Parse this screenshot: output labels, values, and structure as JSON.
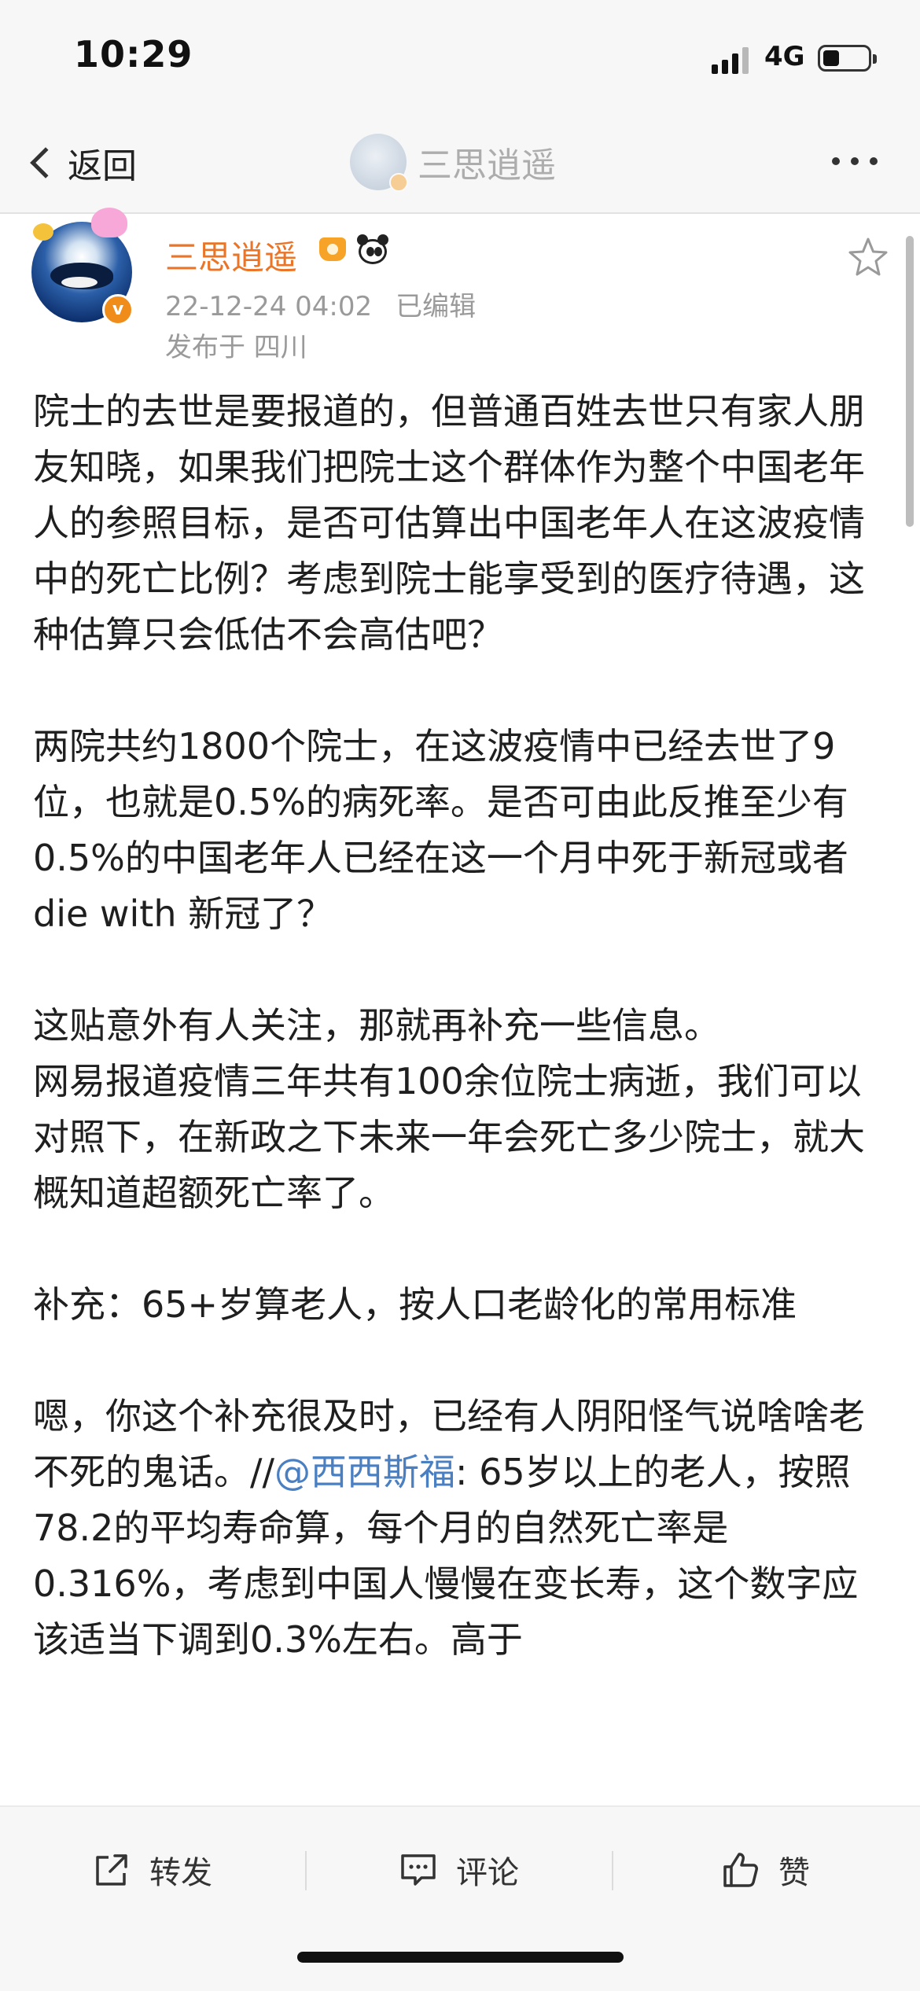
{
  "status_bar": {
    "time": "10:29",
    "network": "4G",
    "signal_icon": "signal-bars-icon",
    "battery_icon": "battery-icon"
  },
  "nav": {
    "back_label": "返回",
    "title": "三思逍遥",
    "more_icon": "more-dots-icon"
  },
  "author": {
    "name": "三思逍遥",
    "timestamp": "22-12-24 04:02",
    "edited": "已编辑",
    "location": "发布于 四川",
    "verified_mark": "v",
    "name_color": "#ea7528"
  },
  "post": {
    "paragraphs": [
      "院士的去世是要报道的，但普通百姓去世只有家人朋友知晓，如果我们把院士这个群体作为整个中国老年人的参照目标，是否可估算出中国老年人在这波疫情中的死亡比例？考虑到院士能享受到的医疗待遇，这种估算只会低估不会高估吧？",
      "两院共约1800个院士，在这波疫情中已经去世了9位，也就是0.5%的病死率。是否可由此反推至少有0.5%的中国老年人已经在这一个月中死于新冠或者 die with 新冠了？",
      "这贴意外有人关注，那就再补充一些信息。\n网易报道疫情三年共有100余位院士病逝，我们可以对照下，在新政之下未来一年会死亡多少院士，就大概知道超额死亡率了。",
      "补充：65+岁算老人，按人口老龄化的常用标准"
    ],
    "last_para_before": "嗯，你这个补充很及时，已经有人阴阳怪气说啥啥老不死的鬼话。//",
    "mention": "@西西斯福",
    "last_para_after": ": 65岁以上的老人，按照78.2的平均寿命算，每个月的自然死亡率是0.316%，考虑到中国人慢慢在变长寿，这个数字应该适当下调到0.3%左右。高于",
    "mention_color": "#4a7fc1"
  },
  "actions": {
    "repost": "转发",
    "comment": "评论",
    "like": "赞"
  }
}
